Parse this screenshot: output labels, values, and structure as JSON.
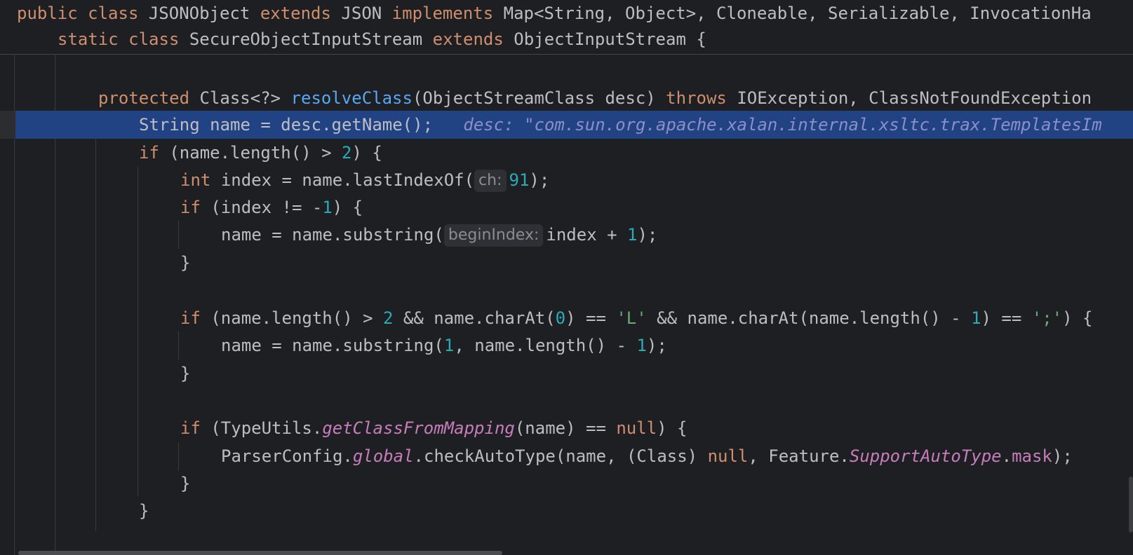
{
  "sticky_header": {
    "line1": {
      "kw_public": "public",
      "kw_class": "class",
      "class_name": "JSONObject",
      "kw_extends": "extends",
      "parent": "JSON",
      "kw_implements": "implements",
      "interfaces": "Map<String, Object>, Cloneable, Serializable, InvocationHa"
    },
    "line2": {
      "kw_static": "static",
      "kw_class": "class",
      "class_name": "SecureObjectInputStream",
      "kw_extends": "extends",
      "parent": "ObjectInputStream {"
    }
  },
  "code": {
    "method_decl": {
      "kw_protected": "protected",
      "return_type": "Class<?>",
      "method_name": "resolveClass",
      "params": "(ObjectStreamClass desc)",
      "kw_throws": "throws",
      "exceptions": "IOException, ClassNotFoundException"
    },
    "exec_line": {
      "code": "String name = desc.getName();",
      "debug_value": "desc: \"com.sun.org.apache.xalan.internal.xsltc.trax.TemplatesIm"
    },
    "if_length": {
      "kw_if": "if",
      "before": "(name.length() > ",
      "num": "2",
      "after": ") {"
    },
    "int_index": {
      "kw_int": "int",
      "before": "index = name.lastIndexOf(",
      "hint": "ch:",
      "num": "91",
      "after": ");"
    },
    "if_index": {
      "kw_if": "if",
      "before": "(index != -",
      "num": "1",
      "after": ") {"
    },
    "substring1": {
      "before": "name = name.substring(",
      "hint": "beginIndex:",
      "middle": "index + ",
      "num": "1",
      "after": ");"
    },
    "close_brace1": "}",
    "if_charat": {
      "kw_if": "if",
      "p1": "(name.length() > ",
      "n1": "2",
      "p2": " && name.charAt(",
      "n2": "0",
      "p3": ") == ",
      "s1": "'L'",
      "p4": " && name.charAt(name.length() - ",
      "n3": "1",
      "p5": ") == ",
      "s2": "';'",
      "p6": ") {"
    },
    "substring2": {
      "p1": "name = name.substring(",
      "n1": "1",
      "p2": ", name.length() - ",
      "n2": "1",
      "p3": ");"
    },
    "close_brace2": "}",
    "if_mapping": {
      "kw_if": "if",
      "p1": "(TypeUtils.",
      "static_method": "getClassFromMapping",
      "p2": "(name) == ",
      "kw_null": "null",
      "p3": ") {"
    },
    "check_auto": {
      "p1": "ParserConfig.",
      "static_field": "global",
      "p2": ".checkAutoType(name, (Class) ",
      "kw_null": "null",
      "p3": ", Feature.",
      "enum_const": "SupportAutoType",
      "p4": ".",
      "field": "mask",
      "p5": ");"
    },
    "close_brace3": "}",
    "close_brace4": "}"
  },
  "colors": {
    "background": "#1e1f22",
    "keyword": "#cf8e6d",
    "method": "#56a8f5",
    "number": "#2aacb8",
    "string": "#6aab73",
    "static_member": "#c77dbb",
    "execution_highlight": "#214283"
  }
}
